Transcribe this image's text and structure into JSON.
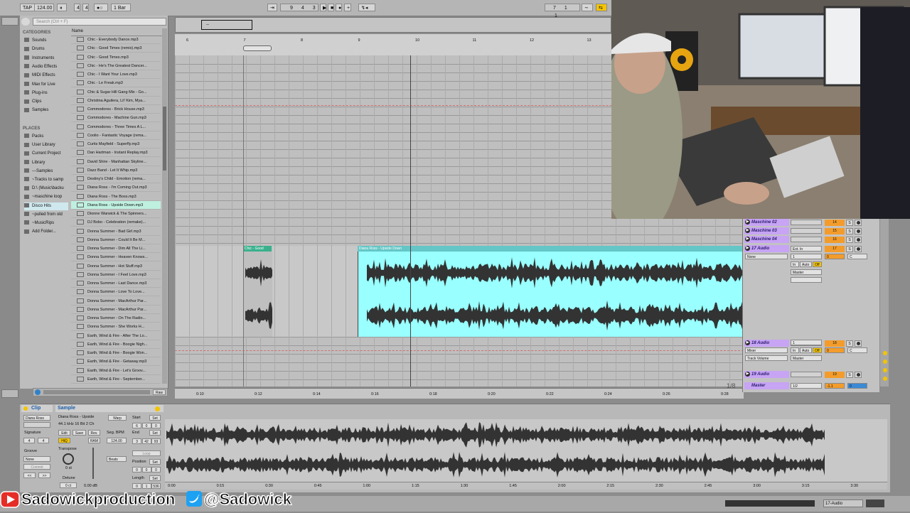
{
  "transport": {
    "tap": "TAP",
    "tempo": "124.00",
    "sig_num": "4",
    "sig_den": "4",
    "quant": "1 Bar",
    "pos_bar": "9",
    "pos_beat": "4",
    "pos_sixteenth": "3",
    "loop_bar": "7",
    "loop_beat": "1",
    "loop_sixteenth": "1"
  },
  "browser": {
    "search_placeholder": "Search (Ctrl + F)",
    "categories_title": "CATEGORIES",
    "categories": [
      "Sounds",
      "Drums",
      "Instruments",
      "Audio Effects",
      "MIDI Effects",
      "Max for Live",
      "Plug-ins",
      "Clips",
      "Samples"
    ],
    "places_title": "PLACES",
    "places": [
      "Packs",
      "User Library",
      "Current Project",
      "Library",
      "---Samples",
      "~Tracks to samp",
      "D:\\ (Music\\backu",
      "~maschine loop",
      "Disco Hits",
      "~pulled from old",
      "~MusicRips",
      "Add Folder..."
    ],
    "name_header": "Name",
    "files": [
      "Chic - Everybody Dance.mp3",
      "Chic - Good Times (remix).mp3",
      "Chic - Good Times.mp3",
      "Chic - He's The Greatest Dancer...",
      "Chic - I Want Your Love.mp3",
      "Chic - Le Freak.mp3",
      "Chic & Sugar Hill Gang Mix - Go...",
      "Christina Aguilera, Lil' Kim, Mya...",
      "Commodores - Brick House.mp3",
      "Commodores - Machine Gun.mp3",
      "Commodores - Three Times A L...",
      "Coolio - Fantastic Voyage (rema...",
      "Curtis Mayfield - Superfly.mp3",
      "Dan Hartman - Instant Replay.mp3",
      "David Shire - Manhattan Skyline...",
      "Dazz Band - Let It Whip.mp3",
      "Destiny's Child - Emotion (rema...",
      "Diana Ross - I'm Coming Out.mp3",
      "Diana Ross - The Boss.mp3",
      "Diana Ross - Upside Down.mp3",
      "Dionne Warwick & The Spinners...",
      "DJ Bobo - Celebration (remake)...",
      "Donna Summer - Bad Girl.mp3",
      "Donna Summer - Could It Be M...",
      "Donna Summer - Dim All The Li...",
      "Donna Summer - Heaven Knows...",
      "Donna Summer - Hot Stuff.mp3",
      "Donna Summer - I Feel Love.mp3",
      "Donna Summer - Last Dance.mp3",
      "Donna Summer - Love To Love...",
      "Donna Summer - MacArthur Par...",
      "Donna Summer - MacArthur Par...",
      "Donna Summer - On The Radio...",
      "Donna Summer - She Works H...",
      "Earth, Wind & Fire - After The Lo...",
      "Earth, Wind & Fire - Boogie Nigh...",
      "Earth, Wind & Fire - Boogie Won...",
      "Earth, Wind & Fire - Getaway.mp3",
      "Earth, Wind & Fire - Let's Groov...",
      "Earth, Wind & Fire - September..."
    ],
    "selected_file_index": 19,
    "raw_label": "Raw"
  },
  "arrangement": {
    "bar_numbers": [
      "6",
      "7",
      "8",
      "9",
      "10",
      "11",
      "12",
      "13"
    ],
    "time_labels": [
      "0:10",
      "0:12",
      "0:14",
      "0:16",
      "0:18",
      "0:20",
      "0:22",
      "0:24",
      "0:26",
      "0:28"
    ],
    "clip_chic": "Chic - Good",
    "clip_diana": "Diana Ross - Upside Down",
    "grid_label": "1/8",
    "overview_label": "--"
  },
  "mixer": {
    "tracks": [
      {
        "name": "Maschine 02",
        "num": "14"
      },
      {
        "name": "Maschine 03",
        "num": "15"
      },
      {
        "name": "Maschine 04",
        "num": "16"
      },
      {
        "name": "17 Audio",
        "num": "17"
      },
      {
        "name": "18 Audio",
        "num": "18"
      },
      {
        "name": "19 Audio",
        "num": "19"
      }
    ],
    "master_label": "Master",
    "master_sel": "1/2",
    "master_vol": "-1.1",
    "master_pan": "0",
    "ext_in": "Ext. In",
    "none": "None",
    "ch1": "1",
    "ch_in": "In",
    "ch_auto": "Auto",
    "ch_off": "Off",
    "ch_master": "Master",
    "vol17": "0",
    "pan17": "C",
    "vol18": "0",
    "pan18": "C",
    "mixer_sel": "Mixer",
    "track_volume": "Track Volume"
  },
  "detail": {
    "clip_tab": "Clip",
    "sample_tab": "Sample",
    "clip_name": "Diana Ross",
    "sample_name": "Diana Ross - Upside",
    "sample_info": "44.1 kHz 16 Bit 2 Ch",
    "signature": "Signature",
    "sig_num": "4",
    "sig_den": "4",
    "groove": "Groove",
    "groove_val": "None",
    "commit": "Commit",
    "edit": "Edit",
    "save": "Save",
    "rev": "Rev.",
    "hiq": "HiQ",
    "ram": "RAM",
    "warp": "Warp",
    "seg_bpm": "Seg. BPM",
    "bpm": "124.00",
    "beats": "Beats",
    "transpose": "Transpose",
    "transpose_val": "0 st",
    "detune": "Detune",
    "detune_val": "0 ct",
    "gain_val": "0.00 dB",
    "start": "Start",
    "start_vals": [
      "6",
      "0",
      "0"
    ],
    "end": "End",
    "end_vals": [
      "3",
      "42",
      "93"
    ],
    "loop": "Loop",
    "position": "Position",
    "pos_vals": [
      "0",
      "0",
      "0"
    ],
    "length": "Length",
    "len_vals": [
      "0",
      "1",
      "536"
    ],
    "set": "Set",
    "time_labels": [
      "0:00",
      "0:15",
      "0:30",
      "0:45",
      "1:00",
      "1:15",
      "1:30",
      "1:45",
      "2:00",
      "2:15",
      "2:30",
      "2:45",
      "3:00",
      "3:15",
      "3:30"
    ]
  },
  "status": {
    "track_label": "17-Audio"
  },
  "overlay": {
    "youtube": "Sadowickproduction",
    "twitter": "@Sadowick"
  },
  "colors": {
    "accent_clip": "#99ffff",
    "chic_clip": "#3ab18d",
    "track_purple": "#c7a4f4",
    "orange": "#f39c2b"
  }
}
